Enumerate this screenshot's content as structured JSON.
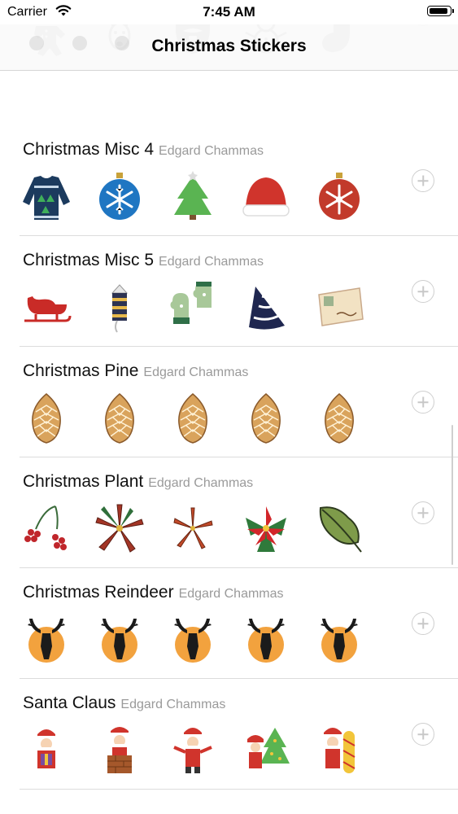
{
  "status_bar": {
    "carrier": "Carrier",
    "time": "7:45 AM",
    "battery_level": 1.0
  },
  "nav": {
    "title": "Christmas Stickers"
  },
  "packs": [
    {
      "name": "",
      "author": "",
      "stickers": [
        "gingerbread-man-sticker",
        "reindeer-face-sticker",
        "beard-sticker",
        "snowman-sticker",
        "stocking-sticker"
      ]
    },
    {
      "name": "Christmas Misc 4",
      "author": "Edgard Chammas",
      "stickers": [
        "ugly-sweater-sticker",
        "snowflake-ornament-sticker",
        "christmas-tree-sticker",
        "santa-hat-sticker",
        "red-ornament-sticker"
      ]
    },
    {
      "name": "Christmas Misc 5",
      "author": "Edgard Chammas",
      "stickers": [
        "sleigh-sticker",
        "firework-sticker",
        "mittens-sticker",
        "party-hat-sticker",
        "postcard-sticker"
      ]
    },
    {
      "name": "Christmas Pine",
      "author": "Edgard Chammas",
      "stickers": [
        "pine-cone-sticker",
        "pine-cone-sticker",
        "pine-cone-sticker",
        "pine-cone-sticker",
        "pine-cone-sticker"
      ]
    },
    {
      "name": "Christmas Plant",
      "author": "Edgard Chammas",
      "stickers": [
        "red-berries-sticker",
        "star-anise-sticker",
        "star-anise-small-sticker",
        "poinsettia-sticker",
        "oak-leaf-sticker"
      ]
    },
    {
      "name": "Christmas Reindeer",
      "author": "Edgard Chammas",
      "stickers": [
        "reindeer-silhouette-sticker",
        "reindeer-silhouette-sticker",
        "reindeer-silhouette-sticker",
        "reindeer-silhouette-sticker",
        "reindeer-silhouette-sticker"
      ]
    },
    {
      "name": "Santa Claus",
      "author": "Edgard Chammas",
      "stickers": [
        "santa-gift-sticker",
        "santa-chimney-sticker",
        "santa-waving-sticker",
        "santa-tree-sticker",
        "santa-sign-sticker"
      ]
    }
  ]
}
